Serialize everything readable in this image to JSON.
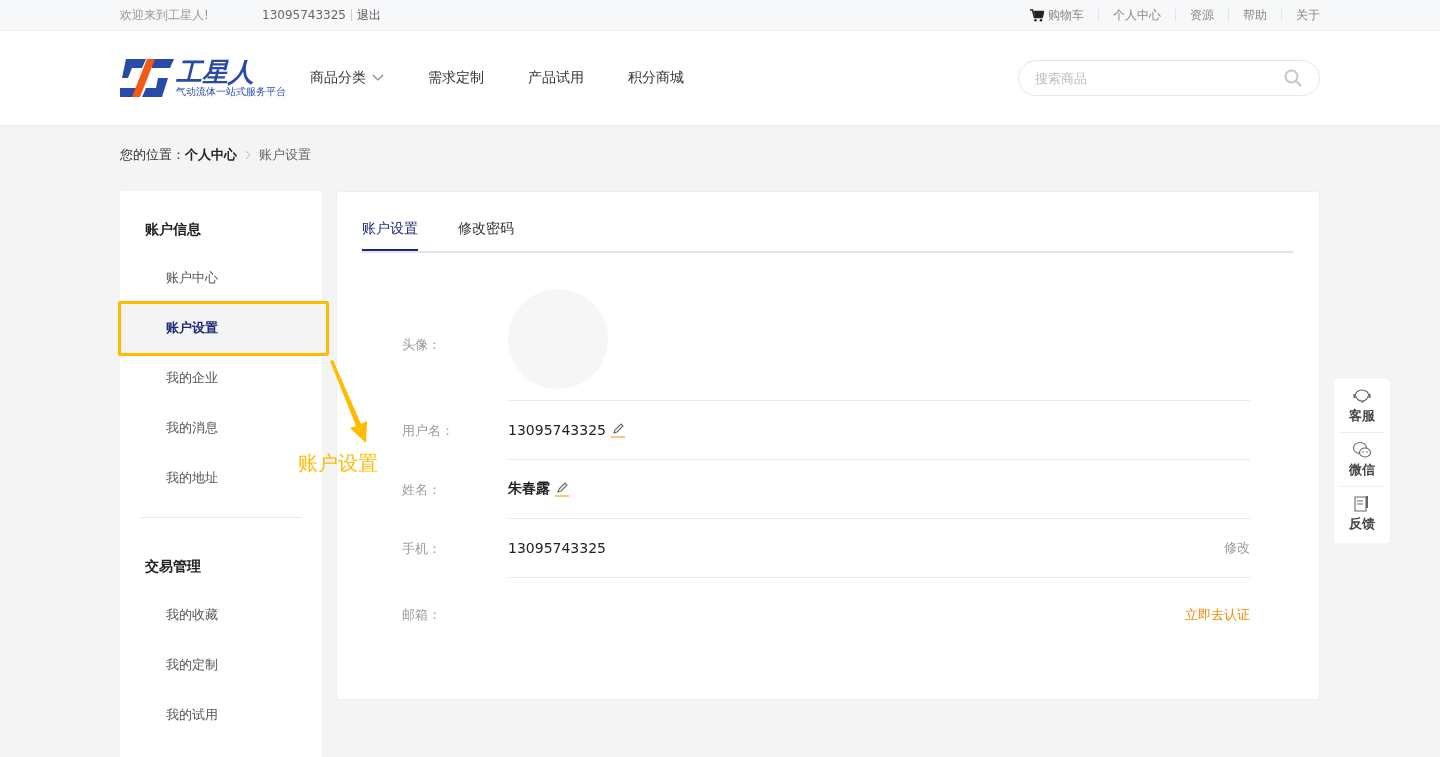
{
  "top_bar": {
    "welcome": "欢迎来到工星人!",
    "phone": "13095743325",
    "logout": "退出",
    "links": [
      {
        "label": "购物车",
        "kind": "cart"
      },
      {
        "label": "个人中心",
        "kind": "plain"
      },
      {
        "label": "资源",
        "kind": "plain"
      },
      {
        "label": "帮助",
        "kind": "plain"
      },
      {
        "label": "关于",
        "kind": "plain"
      }
    ]
  },
  "header": {
    "logo_text": "工星人",
    "logo_slogan": "气动流体一站式服务平台",
    "nav": [
      {
        "label": "商品分类",
        "dropdown": true
      },
      {
        "label": "需求定制",
        "dropdown": false
      },
      {
        "label": "产品试用",
        "dropdown": false
      },
      {
        "label": "积分商城",
        "dropdown": false
      }
    ],
    "search": {
      "placeholder": "搜索商品"
    }
  },
  "breadcrumb": {
    "prefix": "您的位置：",
    "items": [
      "个人中心",
      "账户设置"
    ]
  },
  "sidebar": {
    "groups": [
      {
        "title": "账户信息",
        "items": [
          {
            "label": "账户中心",
            "selected": false
          },
          {
            "label": "账户设置",
            "selected": true
          },
          {
            "label": "我的企业",
            "selected": false
          },
          {
            "label": "我的消息",
            "selected": false
          },
          {
            "label": "我的地址",
            "selected": false
          }
        ]
      },
      {
        "title": "交易管理",
        "items": [
          {
            "label": "我的收藏",
            "selected": false
          },
          {
            "label": "我的定制",
            "selected": false
          },
          {
            "label": "我的试用",
            "selected": false
          }
        ]
      }
    ]
  },
  "tabs": [
    {
      "label": "账户设置",
      "selected": true
    },
    {
      "label": "修改密码",
      "selected": false
    }
  ],
  "form": [
    {
      "label": "头像：",
      "kind": "avatar"
    },
    {
      "label": "用户名：",
      "kind": "editable",
      "value": "13095743325",
      "bold": false
    },
    {
      "label": "姓名：",
      "kind": "editable",
      "value": "朱春露",
      "bold": true
    },
    {
      "label": "手机：",
      "kind": "action",
      "value": "13095743325",
      "action": "修改",
      "highlighted": false
    },
    {
      "label": "邮箱：",
      "kind": "action",
      "action": "立即去认证",
      "highlighted": true
    }
  ],
  "float_tools": [
    {
      "label": "客服",
      "kind": "headset"
    },
    {
      "label": "微信",
      "kind": "chat"
    },
    {
      "label": "反馈",
      "kind": "note"
    }
  ],
  "annotation": {
    "label": "账户设置"
  }
}
